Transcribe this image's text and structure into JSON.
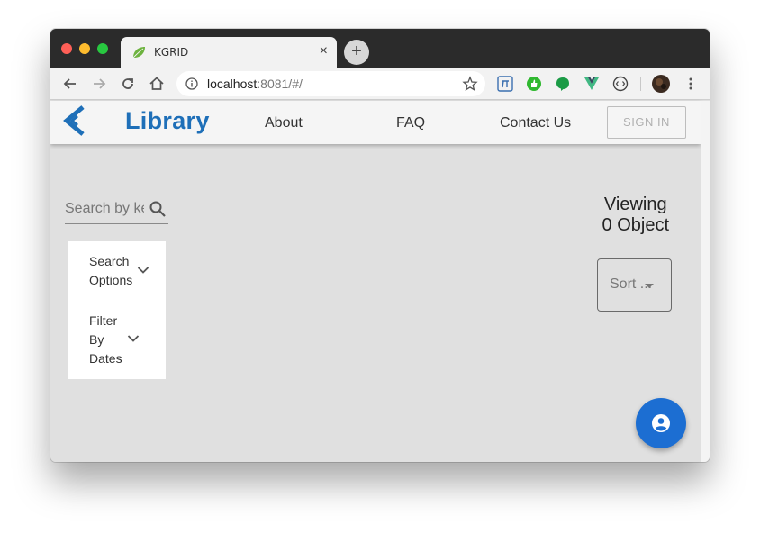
{
  "browser": {
    "tab_title": "KGRID",
    "tab_close": "×",
    "new_tab": "+",
    "url_host": "localhost",
    "url_rest": ":8081/#/"
  },
  "app": {
    "title": "Library",
    "nav": {
      "about": "About",
      "faq": "FAQ",
      "contact": "Contact Us"
    },
    "signin_label": "SIGN IN",
    "search": {
      "placeholder": "Search by keywords"
    },
    "filters": {
      "search_options": [
        "Search",
        "Options"
      ],
      "filter_by_dates": [
        "Filter",
        "By",
        "Dates"
      ]
    },
    "viewing": {
      "line1": "Viewing",
      "line2": "0 Object"
    },
    "sort_label": "Sort ..."
  },
  "colors": {
    "brand": "#1e6fb8",
    "fab": "#1c6ed2",
    "page_bg": "#e0e0e0"
  }
}
